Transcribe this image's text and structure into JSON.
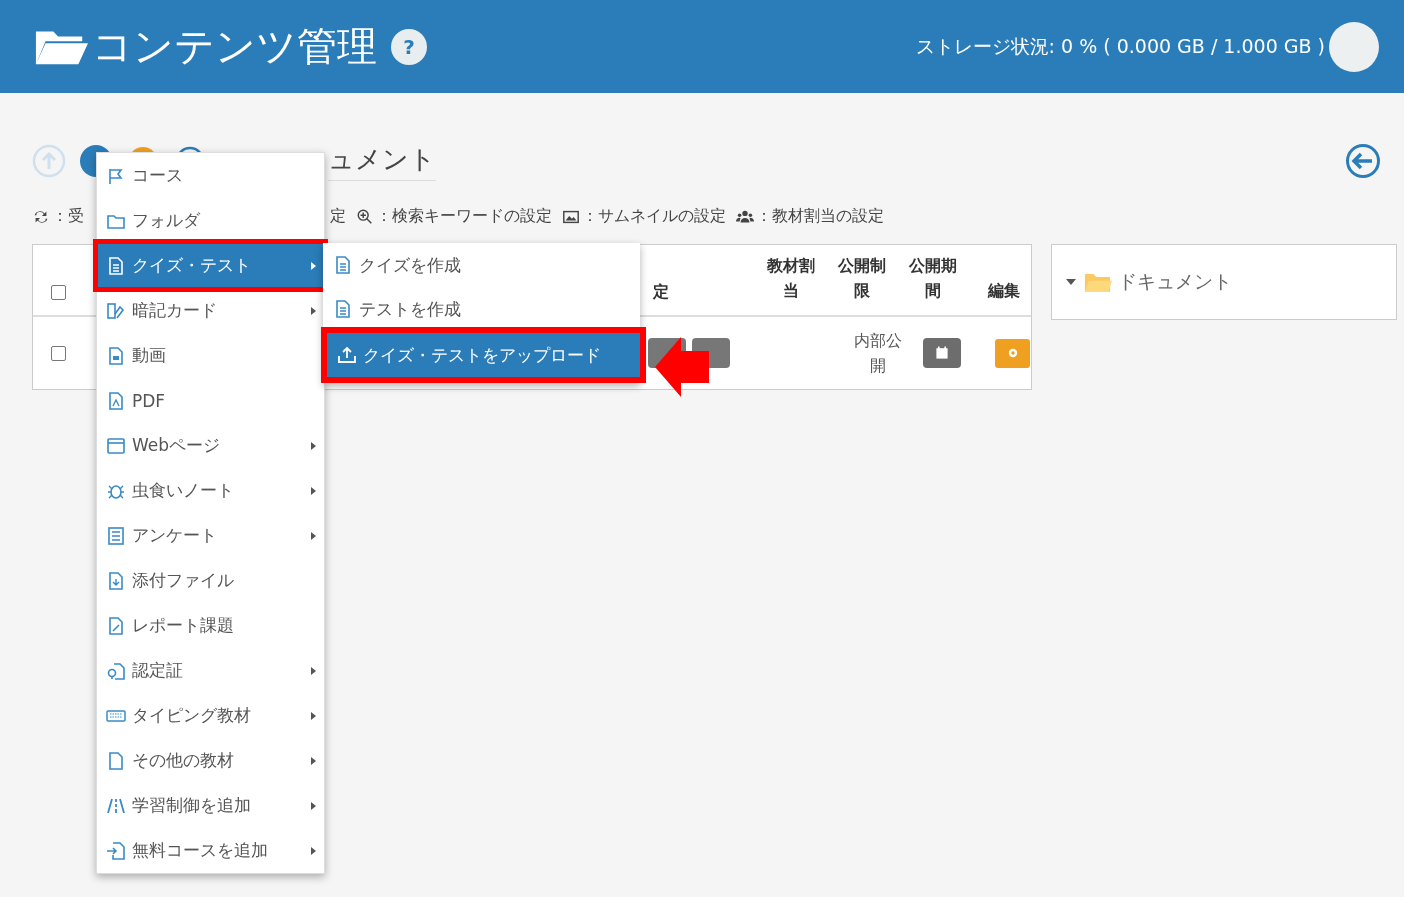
{
  "header": {
    "title": "コンテンツ管理",
    "help": "?",
    "storage": "ストレージ状況: 0 % ( 0.000 GB / 1.000 GB )"
  },
  "breadcrumb": "ュメント",
  "legend": [
    "：受",
    "定",
    "：検索キーワードの設定",
    "：サムネイルの設定",
    "：教材割当の設定"
  ],
  "table": {
    "header_checked": false,
    "columns": [
      "定",
      "教材割当",
      "公開制限",
      "公開期間",
      "編集"
    ],
    "rows": [
      {
        "checked": false,
        "visibility": "内部公開"
      }
    ]
  },
  "tree": {
    "label": "ドキュメント",
    "expanded": true
  },
  "menu": [
    {
      "label": "コース",
      "submenu": false,
      "selected": false
    },
    {
      "label": "フォルダ",
      "submenu": false,
      "selected": false
    },
    {
      "label": "クイズ・テスト",
      "submenu": true,
      "selected": true
    },
    {
      "label": "暗記カード",
      "submenu": true,
      "selected": false
    },
    {
      "label": "動画",
      "submenu": false,
      "selected": false
    },
    {
      "label": "PDF",
      "submenu": false,
      "selected": false
    },
    {
      "label": "Webページ",
      "submenu": true,
      "selected": false
    },
    {
      "label": "虫食いノート",
      "submenu": true,
      "selected": false
    },
    {
      "label": "アンケート",
      "submenu": true,
      "selected": false
    },
    {
      "label": "添付ファイル",
      "submenu": false,
      "selected": false
    },
    {
      "label": "レポート課題",
      "submenu": false,
      "selected": false
    },
    {
      "label": "認定証",
      "submenu": true,
      "selected": false
    },
    {
      "label": "タイピング教材",
      "submenu": true,
      "selected": false
    },
    {
      "label": "その他の教材",
      "submenu": true,
      "selected": false
    },
    {
      "label": "学習制御を追加",
      "submenu": true,
      "selected": false
    },
    {
      "label": "無料コースを追加",
      "submenu": true,
      "selected": false
    }
  ],
  "submenu": [
    {
      "label": "クイズを作成",
      "selected": false
    },
    {
      "label": "テストを作成",
      "selected": false
    },
    {
      "label": "クイズ・テストをアップロード",
      "selected": true
    }
  ]
}
